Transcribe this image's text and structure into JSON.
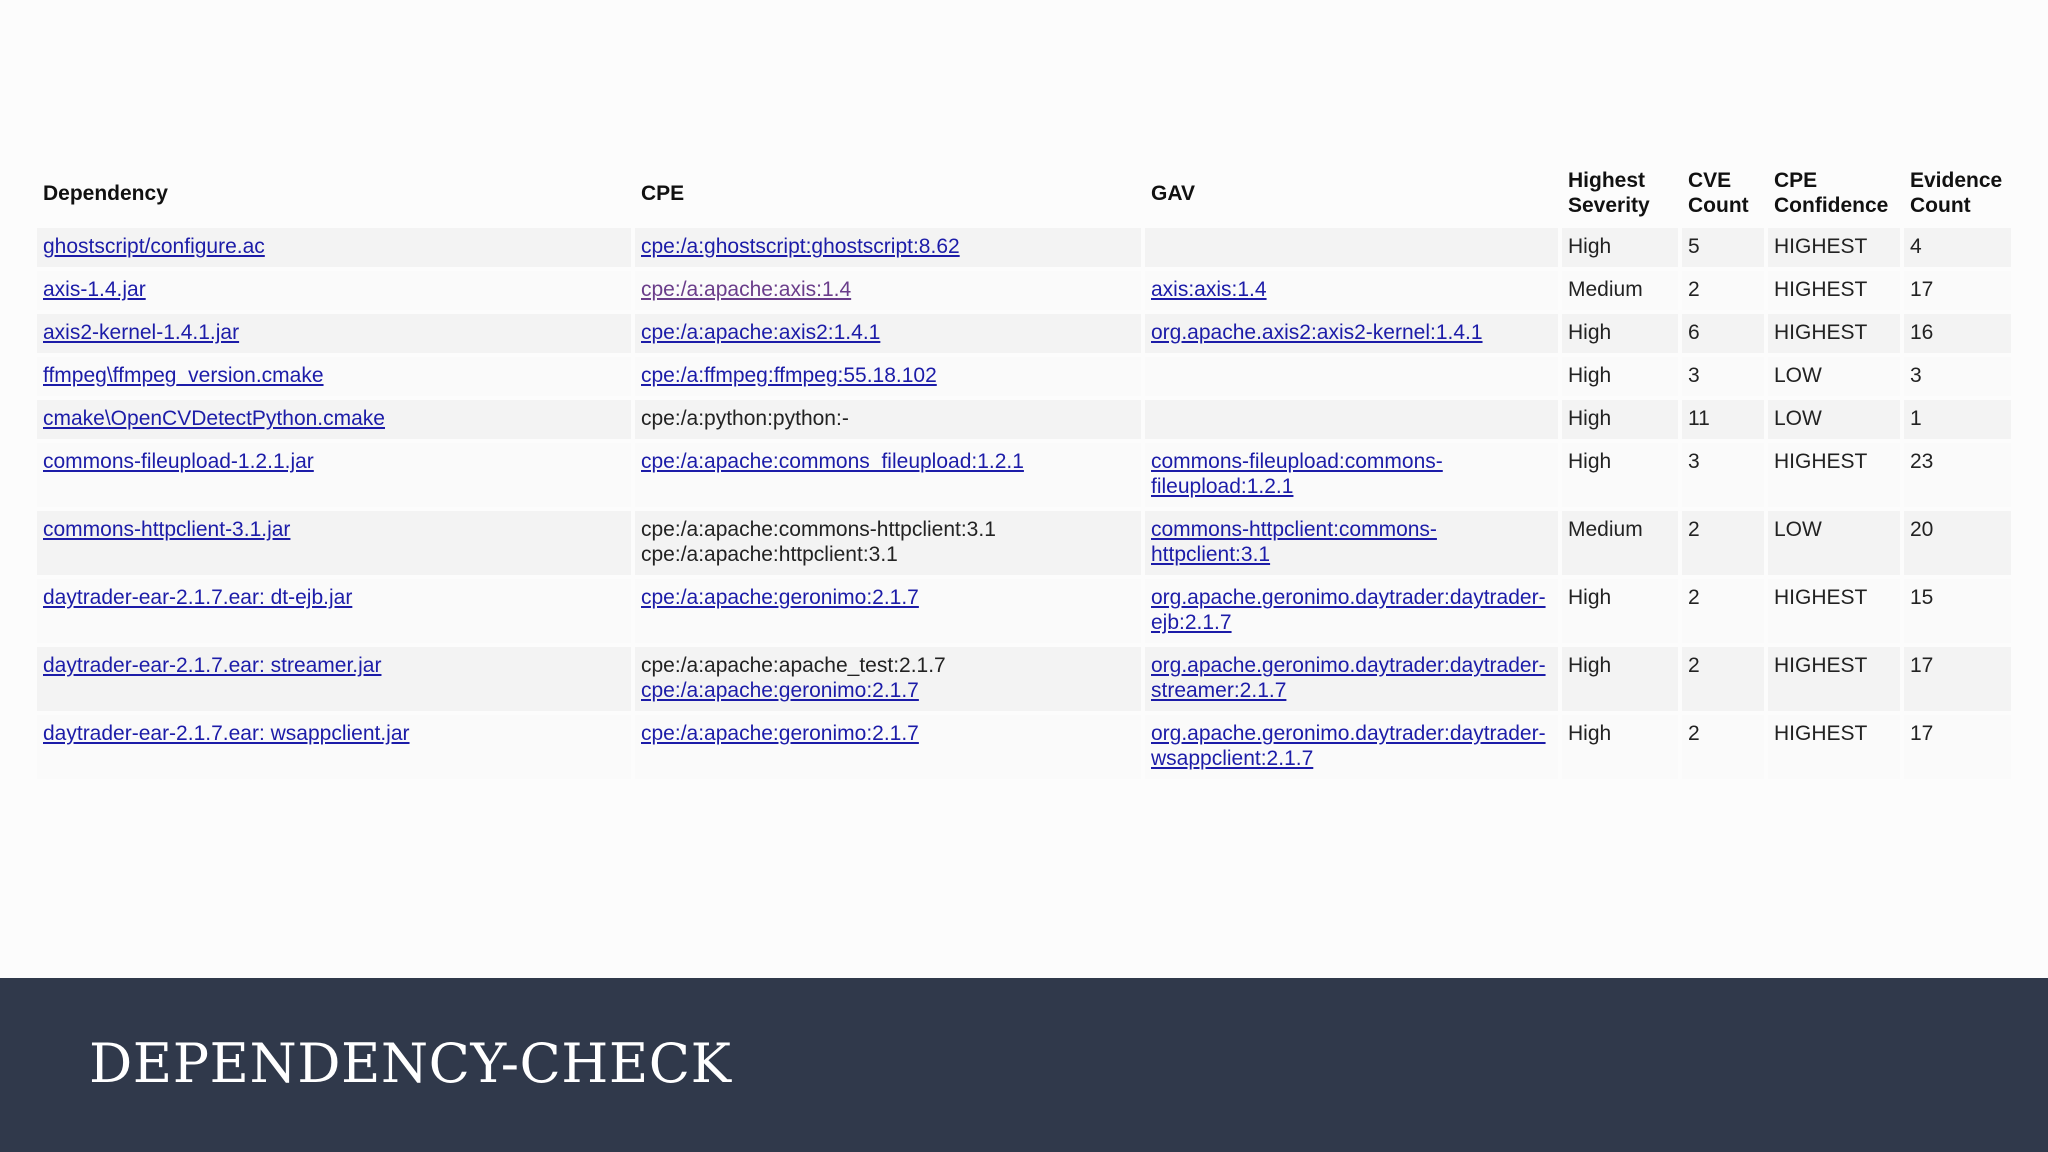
{
  "table": {
    "headers": {
      "dependency": "Dependency",
      "cpe": "CPE",
      "gav": "GAV",
      "highest_severity": "Highest Severity",
      "cve_count": "CVE Count",
      "cpe_confidence": "CPE Confidence",
      "evidence_count": "Evidence Count"
    },
    "rows": [
      {
        "dependency": "ghostscript/configure.ac",
        "cpe": [
          "cpe:/a:ghostscript:ghostscript:8.62"
        ],
        "gav": "",
        "severity": "High",
        "cve": "5",
        "confidence": "HIGHEST",
        "evidence": "4"
      },
      {
        "dependency": "axis-1.4.jar",
        "cpe": [
          "cpe:/a:apache:axis:1.4"
        ],
        "gav": "axis:axis:1.4",
        "severity": "Medium",
        "cve": "2",
        "confidence": "HIGHEST",
        "evidence": "17"
      },
      {
        "dependency": "axis2-kernel-1.4.1.jar",
        "cpe": [
          "cpe:/a:apache:axis2:1.4.1"
        ],
        "gav": "org.apache.axis2:axis2-kernel:1.4.1",
        "severity": "High",
        "cve": "6",
        "confidence": "HIGHEST",
        "evidence": "16"
      },
      {
        "dependency": "ffmpeg\\ffmpeg_version.cmake",
        "cpe": [
          "cpe:/a:ffmpeg:ffmpeg:55.18.102"
        ],
        "gav": "",
        "severity": "High",
        "cve": "3",
        "confidence": "LOW",
        "evidence": "3"
      },
      {
        "dependency": "cmake\\OpenCVDetectPython.cmake",
        "cpe": [
          "cpe:/a:python:python:-"
        ],
        "gav": "",
        "severity": "High",
        "cve": "11",
        "confidence": "LOW",
        "evidence": "1"
      },
      {
        "dependency": "commons-fileupload-1.2.1.jar",
        "cpe": [
          "cpe:/a:apache:commons_fileupload:1.2.1"
        ],
        "gav": "commons-fileupload:commons-fileupload:1.2.1",
        "severity": "High",
        "cve": "3",
        "confidence": "HIGHEST",
        "evidence": "23"
      },
      {
        "dependency": "commons-httpclient-3.1.jar",
        "cpe": [
          "cpe:/a:apache:commons-httpclient:3.1",
          "cpe:/a:apache:httpclient:3.1"
        ],
        "gav": "commons-httpclient:commons-httpclient:3.1",
        "severity": "Medium",
        "cve": "2",
        "confidence": "LOW",
        "evidence": "20"
      },
      {
        "dependency": "daytrader-ear-2.1.7.ear: dt-ejb.jar",
        "cpe": [
          "cpe:/a:apache:geronimo:2.1.7"
        ],
        "gav": "org.apache.geronimo.daytrader:daytrader-ejb:2.1.7",
        "severity": "High",
        "cve": "2",
        "confidence": "HIGHEST",
        "evidence": "15"
      },
      {
        "dependency": "daytrader-ear-2.1.7.ear: streamer.jar",
        "cpe": [
          "cpe:/a:apache:apache_test:2.1.7",
          "cpe:/a:apache:geronimo:2.1.7"
        ],
        "gav": "org.apache.geronimo.daytrader:daytrader-streamer:2.1.7",
        "severity": "High",
        "cve": "2",
        "confidence": "HIGHEST",
        "evidence": "17"
      },
      {
        "dependency": "daytrader-ear-2.1.7.ear: wsappclient.jar",
        "cpe": [
          "cpe:/a:apache:geronimo:2.1.7"
        ],
        "gav": "org.apache.geronimo.daytrader:daytrader-wsappclient:2.1.7",
        "severity": "High",
        "cve": "2",
        "confidence": "HIGHEST",
        "evidence": "17"
      }
    ]
  },
  "footer": {
    "title": "DEPENDENCY-CHECK"
  },
  "colors": {
    "link": "#1c1ca8",
    "visited_link": "#6a3d8a",
    "footer_background": "#30394b",
    "footer_text": "#ffffff"
  }
}
